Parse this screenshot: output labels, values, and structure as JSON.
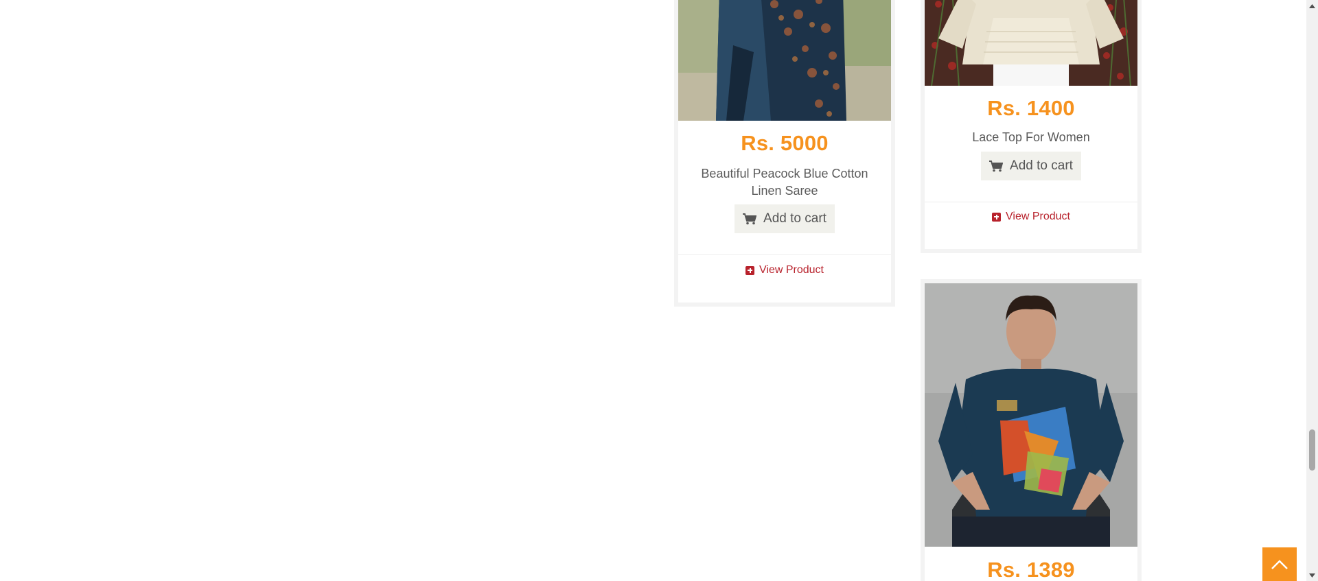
{
  "products": [
    {
      "price": "Rs. 5000",
      "name": "Beautiful Peacock Blue Cotton Linen Saree",
      "add_to_cart": "Add to cart",
      "view_product": "View Product"
    },
    {
      "price": "Rs. 1400",
      "name": "Lace Top For Women",
      "add_to_cart": "Add to cart",
      "view_product": "View Product"
    },
    {
      "price": "Rs. 1389",
      "name": "",
      "add_to_cart": "",
      "view_product": ""
    }
  ],
  "colors": {
    "price": "#f6921e",
    "link": "#b8222c",
    "button_bg": "#f1f1ec",
    "back_to_top": "#f6921e"
  },
  "icons": {
    "cart": "cart-icon",
    "view": "plus-square-icon",
    "back_to_top": "chevron-up-icon"
  }
}
